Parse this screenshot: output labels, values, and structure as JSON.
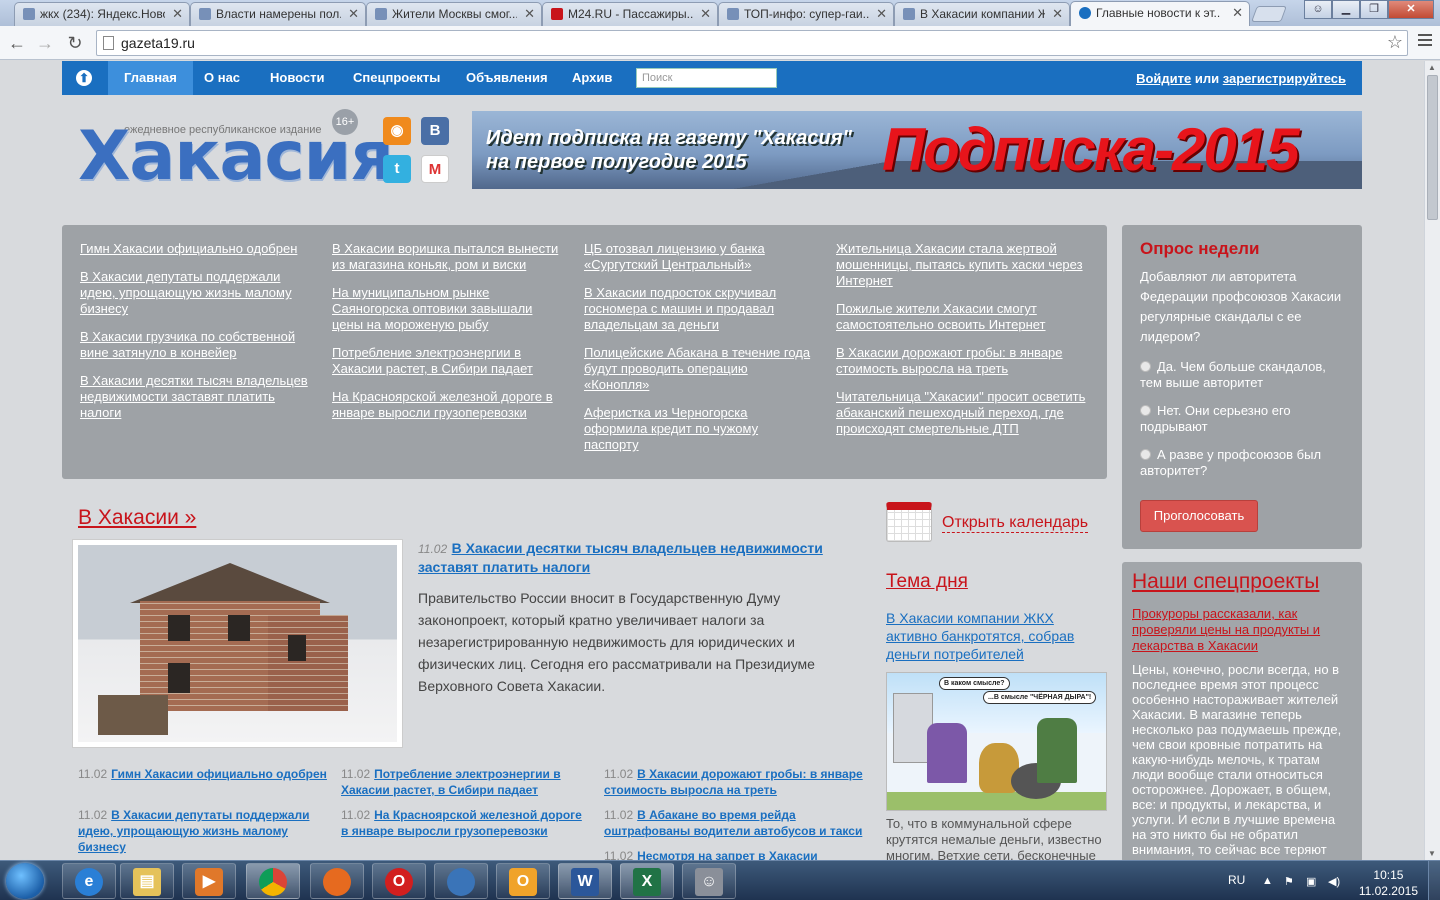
{
  "browser": {
    "tabs": [
      {
        "title": "жкх (234): Яндекс.Новости"
      },
      {
        "title": "Власти намерены пол..."
      },
      {
        "title": "Жители Москвы смог..."
      },
      {
        "title": "M24.RU - Пассажиры..."
      },
      {
        "title": "ТОП-инфо: супер-гаи..."
      },
      {
        "title": "В Хакасии компании Ж..."
      },
      {
        "title": "Главные новости к эт..."
      }
    ],
    "url": "gazeta19.ru"
  },
  "site": {
    "nav": {
      "items": [
        "Главная",
        "О нас",
        "Новости",
        "Спецпроекты",
        "Объявления",
        "Архив"
      ],
      "search_placeholder": "Поиск",
      "login": "Войдите",
      "or": "или",
      "register": "зарегистрируйтесь"
    },
    "logo": {
      "subtitle": "ежедневное республиканское издание",
      "name": "Хакасия",
      "age": "16+"
    },
    "social": [
      "rss-icon",
      "vk-icon",
      "twitter-icon",
      "gmail-icon"
    ],
    "banner": {
      "line1": "Идет подписка на газету \"Хакасия\"",
      "line2": "на первое полугодие 2015",
      "big": "Подписка-2015"
    },
    "headlines": [
      [
        "Гимн Хакасии официально одобрен",
        "В Хакасии депутаты поддержали идею, упрощающую жизнь малому бизнесу",
        "В Хакасии грузчика по собственной вине затянуло в конвейер",
        "В Хакасии десятки тысяч владельцев недвижимости заставят платить налоги"
      ],
      [
        "В Хакасии воришка пытался вынести из магазина коньяк, ром и виски",
        "На муниципальном рынке Саяногорска оптовики завышали цены на мороженую рыбу",
        "Потребление электроэнергии в Хакасии растет, в Сибири падает",
        "На Красноярской железной дороге в январе выросли грузоперевозки"
      ],
      [
        "ЦБ отозвал лицензию у банка «Сургутский Центральный»",
        "В Хакасии подросток скручивал госномера с машин и продавал владельцам за деньги",
        "Полицейские Абакана в течение года будут проводить операцию «Конопля»",
        "Аферистка из Черногорска оформила кредит по чужому паспорту"
      ],
      [
        "Жительница Хакасии стала жертвой мошенницы, пытаясь купить хаски через Интернет",
        "Пожилые жители Хакасии смогут самостоятельно освоить Интернет",
        "В Хакасии дорожают гробы: в январе стоимость выросла на треть",
        "Читательница \"Хакасии\" просит осветить абаканский пешеходный переход, где происходят смертельные ДТП"
      ]
    ],
    "poll": {
      "title": "Опрос недели",
      "question": "Добавляют ли авторитета Федерации профсоюзов Хакасии регулярные скандалы с ее лидером?",
      "options": [
        "Да. Чем больше скандалов, тем выше авторитет",
        "Нет. Они серьезно его подрывают",
        "А разве у профсоюзов был авторитет?"
      ],
      "vote": "Проголосовать"
    },
    "section": {
      "title": "В Хакасии »",
      "main": {
        "date": "11.02",
        "title": "В Хакасии десятки тысяч владельцев недвижимости заставят платить налоги",
        "text": "Правительство России вносит в Государственную Думу законопроект, который кратно увеличивает налоги за незарегистрированную недвижимость для юридических и физических лиц. Сегодня его рассматривали на Президиуме Верховного Совета Хакасии."
      },
      "news": [
        {
          "date": "11.02",
          "title": "Гимн Хакасии официально одобрен"
        },
        {
          "date": "11.02",
          "title": "В Хакасии депутаты поддержали идею, упрощающую жизнь малому бизнесу"
        },
        {
          "date": "11.02",
          "title": "Потребление электроэнергии в Хакасии растет, в Сибири падает"
        },
        {
          "date": "11.02",
          "title": "На Красноярской железной дороге в январе выросли грузоперевозки"
        },
        {
          "date": "11.02",
          "title": "В Хакасии дорожают гробы: в январе стоимость выросла на треть"
        },
        {
          "date": "11.02",
          "title": "В Абакане во время рейда оштрафованы водители автобусов и такси"
        },
        {
          "date": "11.02",
          "title": "Несмотря на запрет в Хакасии"
        }
      ]
    },
    "calendar": "Открыть календарь",
    "topic": {
      "title": "Тема дня",
      "link": "В Хакасии компании ЖКХ активно банкротятся, собрав деньги потребителей",
      "bubble1": "В каком смысле?",
      "bubble2": "...В смысле \"ЧЁРНАЯ ДЫРА\"!",
      "text": "То, что в коммунальной сфере крутятся немалые деньги, известно многим. Ветхие сети, бесконечные"
    },
    "projects": {
      "title": "Наши спецпроекты",
      "link": "Прокуроры рассказали, как проверяли цены на продукты и лекарства в Хакасии",
      "text": "Цены, конечно, росли всегда, но в последнее время этот процесс особенно настораживает жителей Хакасии. В магазине теперь несколько раз подумаешь прежде, чем свои кровные потратить на какую-нибудь мелочь, к тратам люди вообще стали относиться осторожнее. Дорожает, в общем, все: и продукты, и лекарства, и услуги. И если в лучшие времена на это никто бы не обратил внимания, то сейчас все теряют"
    }
  },
  "taskbar": {
    "apps": [
      "ie-icon",
      "explorer-icon",
      "media-player-icon",
      "chrome-icon",
      "firefox-icon",
      "opera-icon",
      "thunderbird-icon",
      "outlook-icon",
      "word-icon",
      "excel-icon",
      "people-icon"
    ],
    "lang": "RU",
    "time": "10:15",
    "date": "11.02.2015"
  },
  "colors": {
    "brand_blue": "#1a6fc0",
    "accent_red": "#c8141b",
    "panel_gray": "#9ea2a6"
  }
}
